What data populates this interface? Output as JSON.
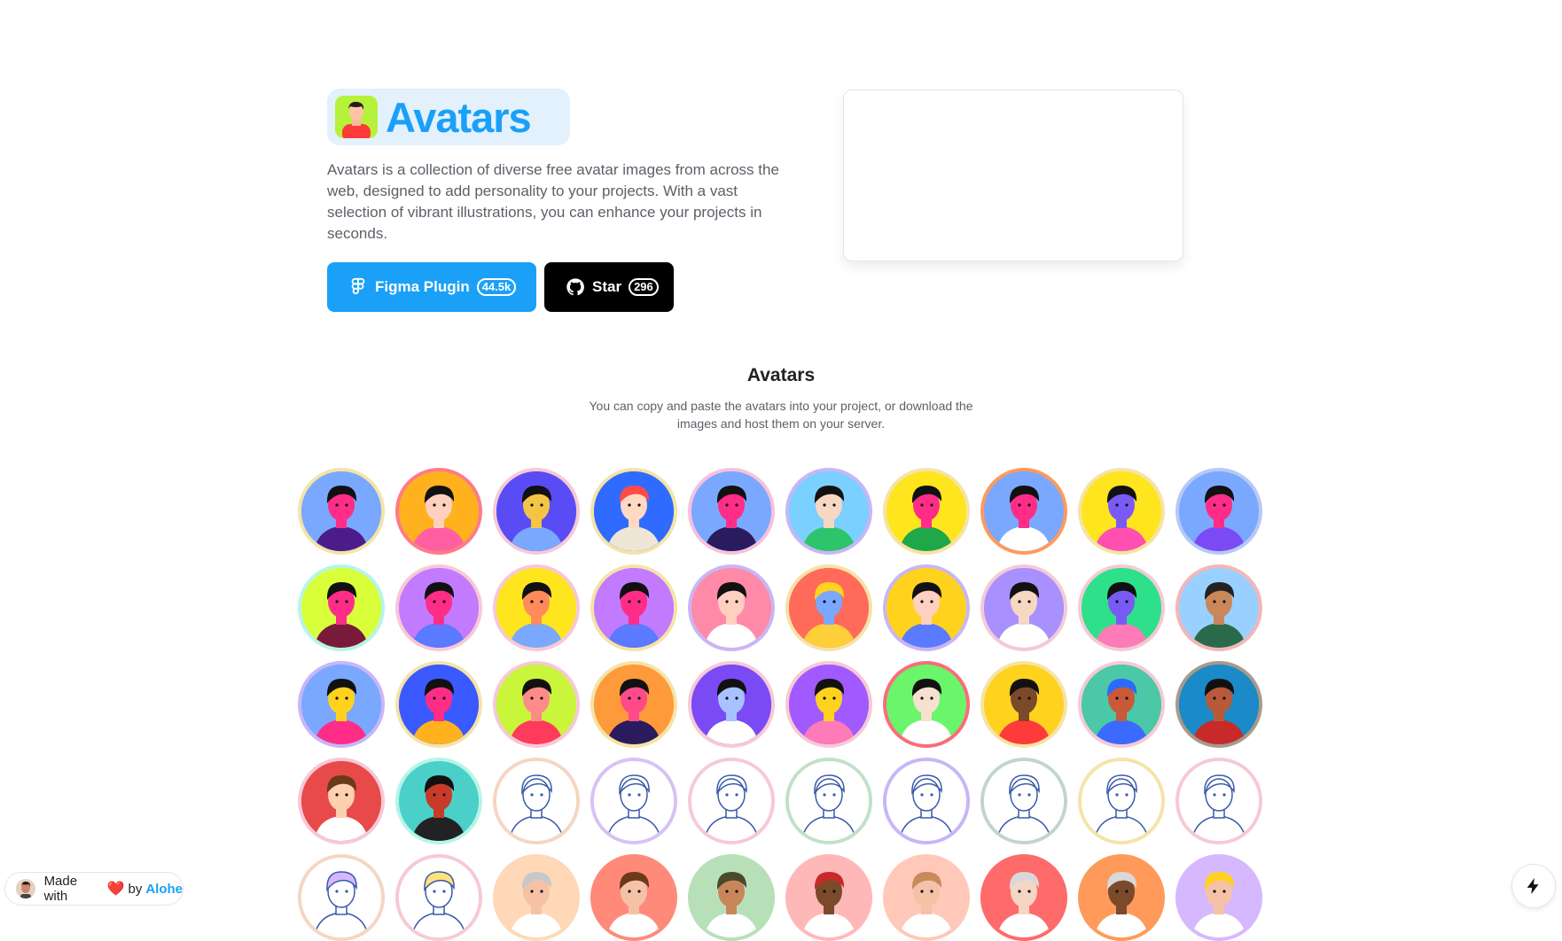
{
  "hero": {
    "logo_text": "Avatars",
    "description": "Avatars is a collection of diverse free avatar images from across the web, designed to add personality to your projects. With a vast selection of vibrant illustrations, you can enhance your projects in seconds.",
    "figma_button": {
      "label": "Figma Plugin",
      "count": "44.5k",
      "icon": "figma-icon"
    },
    "star_button": {
      "label": "Star",
      "count": "296",
      "icon": "github-icon"
    }
  },
  "section": {
    "title": "Avatars",
    "subtitle": "You can copy and paste the avatars into your project, or download the images and host them on your server."
  },
  "avatars": [
    {
      "bg": "#7aa8ff",
      "ring": "#f5e3a8",
      "skin": "#ff2d87",
      "hair": "#111111",
      "shirt": "#4c1d8a"
    },
    {
      "bg": "#ffb21e",
      "ring": "#ff7a8a",
      "skin": "#ffd0c0",
      "hair": "#111111",
      "shirt": "#ff5fa2"
    },
    {
      "bg": "#5a4cf5",
      "ring": "#f6c9d6",
      "skin": "#f4c542",
      "hair": "#111111",
      "shirt": "#7aa8ff"
    },
    {
      "bg": "#2f6bff",
      "ring": "#f5e3a8",
      "skin": "#ffd9c2",
      "hair": "#ff4a4a",
      "shirt": "#f0e6d6"
    },
    {
      "bg": "#7aa8ff",
      "ring": "#f7c1de",
      "skin": "#ff2d87",
      "hair": "#111111",
      "shirt": "#2a1a5e"
    },
    {
      "bg": "#7ad0ff",
      "ring": "#c8b6f5",
      "skin": "#f6d7c2",
      "hair": "#111111",
      "shirt": "#2ec46b"
    },
    {
      "bg": "#ffe51e",
      "ring": "#f5e3a8",
      "skin": "#ff2d87",
      "hair": "#111111",
      "shirt": "#1fa84a"
    },
    {
      "bg": "#7aa8ff",
      "ring": "#ff9a5a",
      "skin": "#ff2d87",
      "hair": "#111111",
      "shirt": "#ffffff"
    },
    {
      "bg": "#ffe51e",
      "ring": "#f5e3a8",
      "skin": "#7a5af5",
      "hair": "#111111",
      "shirt": "#ff4fb0"
    },
    {
      "bg": "#7aa8ff",
      "ring": "#b6c9f5",
      "skin": "#ff2d87",
      "hair": "#111111",
      "shirt": "#7a4af5"
    },
    {
      "bg": "#d9ff3b",
      "ring": "#b6f5e8",
      "skin": "#ff2d87",
      "hair": "#111111",
      "shirt": "#7a1a3a"
    },
    {
      "bg": "#c27aff",
      "ring": "#f6c9d6",
      "skin": "#ff2d87",
      "hair": "#111111",
      "shirt": "#5a7aff"
    },
    {
      "bg": "#ffe51e",
      "ring": "#f6c9d6",
      "skin": "#ff8a5a",
      "hair": "#111111",
      "shirt": "#7aa8ff"
    },
    {
      "bg": "#c27aff",
      "ring": "#f5e3a8",
      "skin": "#ff2d87",
      "hair": "#111111",
      "shirt": "#5a7aff"
    },
    {
      "bg": "#ff8aa8",
      "ring": "#c8b6f5",
      "skin": "#ffd0c0",
      "hair": "#111111",
      "shirt": "#ffffff"
    },
    {
      "bg": "#ff6a5a",
      "ring": "#f5e3a8",
      "skin": "#7aa8ff",
      "hair": "#ffd21e",
      "shirt": "#ffcf3a"
    },
    {
      "bg": "#ffd21e",
      "ring": "#c8b6f5",
      "skin": "#ffd0c0",
      "hair": "#111111",
      "shirt": "#5a7aff"
    },
    {
      "bg": "#a890ff",
      "ring": "#f6c9d6",
      "skin": "#f6d7c2",
      "hair": "#111111",
      "shirt": "#ffffff"
    },
    {
      "bg": "#2ee08a",
      "ring": "#f5c9d6",
      "skin": "#7a5af5",
      "hair": "#111111",
      "shirt": "#ff7ab8"
    },
    {
      "bg": "#9ad0ff",
      "ring": "#f5b6b6",
      "skin": "#c9875a",
      "hair": "#222222",
      "shirt": "#2a6a4a"
    },
    {
      "bg": "#7aa8ff",
      "ring": "#c8b6f5",
      "skin": "#ffd21e",
      "hair": "#111111",
      "shirt": "#ff2d87"
    },
    {
      "bg": "#3a5aff",
      "ring": "#f5e3a8",
      "skin": "#ff2d87",
      "hair": "#111111",
      "shirt": "#ffb21e"
    },
    {
      "bg": "#c9f53b",
      "ring": "#f6c9d6",
      "skin": "#ff8a8a",
      "hair": "#111111",
      "shirt": "#ff3a5a"
    },
    {
      "bg": "#ff9a3a",
      "ring": "#f5e3a8",
      "skin": "#ff4a8a",
      "hair": "#111111",
      "shirt": "#2a1a5e"
    },
    {
      "bg": "#7a4af5",
      "ring": "#f6c9d6",
      "skin": "#a8c2ff",
      "hair": "#111111",
      "shirt": "#ffffff"
    },
    {
      "bg": "#a05aff",
      "ring": "#f6c9d6",
      "skin": "#ffd21e",
      "hair": "#111111",
      "shirt": "#ff7ab8"
    },
    {
      "bg": "#6af56a",
      "ring": "#ff6a7a",
      "skin": "#f6e0d0",
      "hair": "#111111",
      "shirt": "#ffffff"
    },
    {
      "bg": "#ffd21e",
      "ring": "#f5e3a8",
      "skin": "#7a4a2a",
      "hair": "#111111",
      "shirt": "#ff3a3a"
    },
    {
      "bg": "#4ac8a8",
      "ring": "#f6c9d6",
      "skin": "#c85a3a",
      "hair": "#2a6aff",
      "shirt": "#3a6aff"
    },
    {
      "bg": "#1a8ac8",
      "ring": "#a89a8a",
      "skin": "#b85a3a",
      "hair": "#111111",
      "shirt": "#c82a2a"
    },
    {
      "bg": "#e84a4a",
      "ring": "#f6c9d6",
      "skin": "#ffd0b0",
      "hair": "#6a3a1a",
      "shirt": "#ffffff"
    },
    {
      "bg": "#4ad0c8",
      "ring": "#b6f5e8",
      "skin": "#c83a2a",
      "hair": "#111111",
      "shirt": "#222222"
    },
    {
      "bg": "#ffffff",
      "ring": "#f5d6c2",
      "skin": "#ffffff",
      "hair": "#ffffff",
      "shirt": "#ffffff"
    },
    {
      "bg": "#ffffff",
      "ring": "#d6c2f5",
      "skin": "#ffffff",
      "hair": "#ffffff",
      "shirt": "#ffffff"
    },
    {
      "bg": "#ffffff",
      "ring": "#f6c9d6",
      "skin": "#ffffff",
      "hair": "#ffffff",
      "shirt": "#ffffff"
    },
    {
      "bg": "#ffffff",
      "ring": "#c2e0c8",
      "skin": "#ffffff",
      "hair": "#ffffff",
      "shirt": "#ffffff"
    },
    {
      "bg": "#ffffff",
      "ring": "#c8b6f5",
      "skin": "#ffffff",
      "hair": "#ffffff",
      "shirt": "#ffffff"
    },
    {
      "bg": "#ffffff",
      "ring": "#c2d6c8",
      "skin": "#ffffff",
      "hair": "#ffffff",
      "shirt": "#ffffff"
    },
    {
      "bg": "#ffffff",
      "ring": "#f5e3a8",
      "skin": "#ffffff",
      "hair": "#ffffff",
      "shirt": "#ffffff"
    },
    {
      "bg": "#ffffff",
      "ring": "#f6c9d6",
      "skin": "#ffffff",
      "hair": "#ffffff",
      "shirt": "#ffffff"
    },
    {
      "bg": "#ffffff",
      "ring": "#f5d6c2",
      "skin": "#ffffff",
      "hair": "#d8b6ff",
      "shirt": "#ffffff"
    },
    {
      "bg": "#ffffff",
      "ring": "#f6c9d6",
      "skin": "#ffffff",
      "hair": "#ffe27a",
      "shirt": "#ffffff"
    },
    {
      "bg": "#ffd8b8",
      "ring": "#ffd8b8",
      "skin": "#f5c2a8",
      "hair": "#c8c8c8",
      "shirt": "#ffffff"
    },
    {
      "bg": "#ff8a7a",
      "ring": "#ff8a7a",
      "skin": "#f5c2a8",
      "hair": "#6a3a1a",
      "shirt": "#ffffff"
    },
    {
      "bg": "#b8e0b8",
      "ring": "#b8e0b8",
      "skin": "#c8875a",
      "hair": "#4a4a2a",
      "shirt": "#ffffff"
    },
    {
      "bg": "#ffb8b8",
      "ring": "#ffb8b8",
      "skin": "#7a4a2a",
      "hair": "#c82a2a",
      "shirt": "#ffffff"
    },
    {
      "bg": "#ffc8b8",
      "ring": "#ffc8b8",
      "skin": "#f5c2a8",
      "hair": "#c88a5a",
      "shirt": "#ffffff"
    },
    {
      "bg": "#ff6a6a",
      "ring": "#ff6a6a",
      "skin": "#f5d6c2",
      "hair": "#d8d8d8",
      "shirt": "#ffffff"
    },
    {
      "bg": "#ff9a5a",
      "ring": "#ff9a5a",
      "skin": "#7a4a2a",
      "hair": "#d8d8d8",
      "shirt": "#ffffff"
    },
    {
      "bg": "#d6b8ff",
      "ring": "#d6b8ff",
      "skin": "#f5c2a8",
      "hair": "#ffd21e",
      "shirt": "#ffffff"
    }
  ],
  "footer": {
    "made_with": "Made with",
    "heart": "❤️",
    "by": "by",
    "author": "Alohe",
    "bolt_icon": "bolt-icon"
  }
}
